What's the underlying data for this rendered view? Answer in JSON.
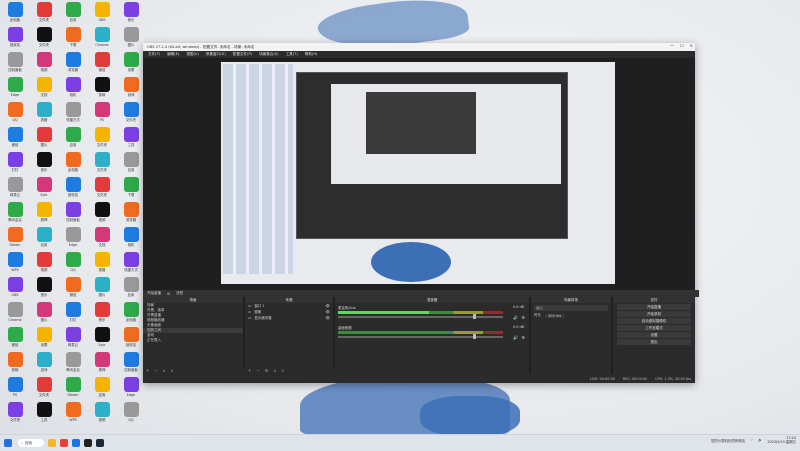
{
  "window": {
    "title": "OBS 27.2.4 (64-bit, windows) - 配置文件: 未命名 - 场景: 未命名",
    "controls": [
      "—",
      "☐",
      "✕"
    ]
  },
  "menu": [
    "文件(F)",
    "编辑(E)",
    "视图(V)",
    "停靠窗口(D)",
    "配置文件(P)",
    "场景集合(S)",
    "工具(T)",
    "帮助(H)"
  ],
  "dockbar": {
    "label": "开始直播",
    "source_tools": [
      "⚙",
      "滤镜"
    ]
  },
  "scenes": {
    "header": "场景",
    "items": [
      "场景",
      "开黑、接单",
      "开黑直播",
      "视频播放器",
      "头像画面",
      "回放之间",
      "游戏",
      "正在载入"
    ],
    "selected_index": 5,
    "footer": [
      "+",
      "−",
      "∧",
      "∨"
    ]
  },
  "sources": {
    "header": "来源",
    "items": [
      "窗口 1",
      "图像",
      "显示器采集"
    ],
    "footer": [
      "+",
      "−",
      "⚙",
      "∧",
      "∨"
    ]
  },
  "mixer": {
    "header": "混音器",
    "tracks": [
      {
        "name": "麦克风/Aux",
        "db": "0.0 dB",
        "level_fraction": 0.55,
        "volume_fraction": 0.82
      },
      {
        "name": "桌面音频",
        "db": "0.0 dB",
        "level_fraction": 0.0,
        "volume_fraction": 0.82
      }
    ]
  },
  "transitions": {
    "header": "场景转场",
    "type": "淡入",
    "duration_label": "时长",
    "duration": "300 ms"
  },
  "controls": {
    "header": "控件",
    "buttons": [
      "开始直播",
      "开始录制",
      "启动虚拟摄像机",
      "工作室模式",
      "设置",
      "退出"
    ]
  },
  "status": {
    "items": [
      "LIVE: 00:00:00",
      "REC: 00:00:00",
      "CPU: 1.3%, 30.00 fps"
    ]
  },
  "taskbar": {
    "search_placeholder": "搜索",
    "tray_text": "您的计算机仍然有风险",
    "time": "17:24",
    "date": "2023/5/19 星期五"
  },
  "desktop_icons": [
    "此电脑",
    "回收站",
    "控制面板",
    "Edge",
    "QQ",
    "微信",
    "钉钉",
    "网易云",
    "腾讯会议",
    "Steam",
    "WPS",
    "OBS",
    "Chrome",
    "微信",
    "剪映",
    "PS",
    "文件夹",
    "文件夹",
    "文件夹",
    "视频",
    "文档",
    "表格",
    "图片",
    "音乐",
    "Epic",
    "原神",
    "应用",
    "视频",
    "音乐",
    "图片",
    "设置",
    "游戏",
    "文件夹",
    "工具",
    "应用",
    "下载",
    "浏览器",
    "相机",
    "快捷方式",
    "应用"
  ],
  "colors": {
    "accent": "#3d6fb6",
    "meter_green": "#5fd65f",
    "obs_bg": "#2b2b2b"
  }
}
